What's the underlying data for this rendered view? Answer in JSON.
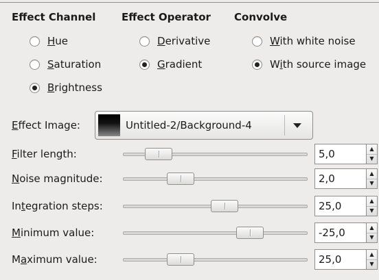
{
  "headers": {
    "effect_channel": "Effect Channel",
    "effect_operator": "Effect Operator",
    "convolve": "Convolve"
  },
  "effect_channel": [
    {
      "key": "H",
      "rest": "ue",
      "selected": false
    },
    {
      "key": "S",
      "rest": "aturation",
      "selected": false
    },
    {
      "key": "B",
      "rest": "rightness",
      "selected": true
    }
  ],
  "effect_operator": [
    {
      "key": "D",
      "rest": "erivative",
      "selected": false
    },
    {
      "key": "G",
      "rest": "radient",
      "selected": true
    }
  ],
  "convolve": [
    {
      "pre": "",
      "key": "W",
      "rest": "ith white noise",
      "selected": false
    },
    {
      "pre": "W",
      "key": "i",
      "rest": "th source image",
      "selected": true
    }
  ],
  "effect_image": {
    "label_key": "E",
    "label_rest": "ffect Image:",
    "value": "Untitled-2/Background-4"
  },
  "sliders": [
    {
      "pre": "",
      "key": "F",
      "rest": "ilter length:",
      "value": "5,0",
      "position": 0.14
    },
    {
      "pre": "",
      "key": "N",
      "rest": "oise magnitude:",
      "value": "2,0",
      "position": 0.28
    },
    {
      "pre": "In",
      "key": "t",
      "rest": "egration steps:",
      "value": "25,0",
      "position": 0.56
    },
    {
      "pre": "",
      "key": "M",
      "rest": "inimum value:",
      "value": "-25,0",
      "position": 0.72
    },
    {
      "pre": "M",
      "key": "a",
      "rest": "ximum value:",
      "value": "25,0",
      "position": 0.28
    }
  ]
}
